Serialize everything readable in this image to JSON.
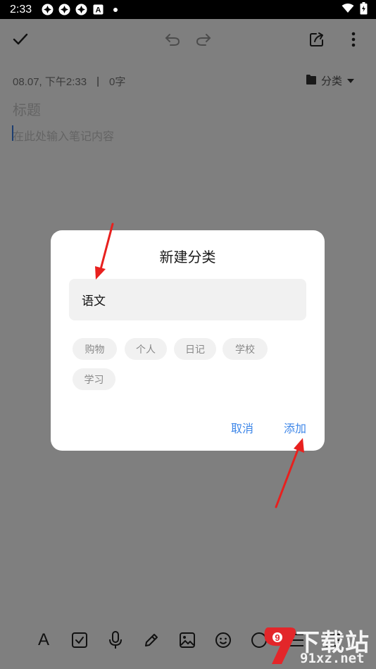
{
  "status_bar": {
    "time": "2:33",
    "icons": [
      "app-notification-icon",
      "app-notification-icon",
      "app-notification-icon",
      "a-icon",
      "dot-icon"
    ],
    "right_icons": [
      "wifi-icon",
      "battery-icon"
    ]
  },
  "toolbar": {
    "icons": [
      "check-icon",
      "undo-icon",
      "redo-icon",
      "share-icon",
      "more-icon"
    ]
  },
  "note": {
    "date": "08.07, 下午2:33",
    "separator": "|",
    "word_count": "0字",
    "category_label": "分类",
    "title_placeholder": "标题",
    "body_placeholder": "在此处输入笔记内容"
  },
  "dialog": {
    "title": "新建分类",
    "input_value": "语文",
    "chips": [
      "购物",
      "个人",
      "日记",
      "学校",
      "学习"
    ],
    "cancel_label": "取消",
    "add_label": "添加",
    "accent_color": "#3d86e8"
  },
  "bottom_toolbar": {
    "text_format_label": "A",
    "icons": [
      "text-format-icon",
      "checkbox-icon",
      "microphone-icon",
      "pen-icon",
      "image-icon",
      "emoji-icon",
      "palette-icon",
      "list-icon",
      "bullet-list-icon"
    ]
  },
  "watermark": {
    "title": "下载站",
    "url": "91xz.net",
    "logo_mark": "9"
  }
}
